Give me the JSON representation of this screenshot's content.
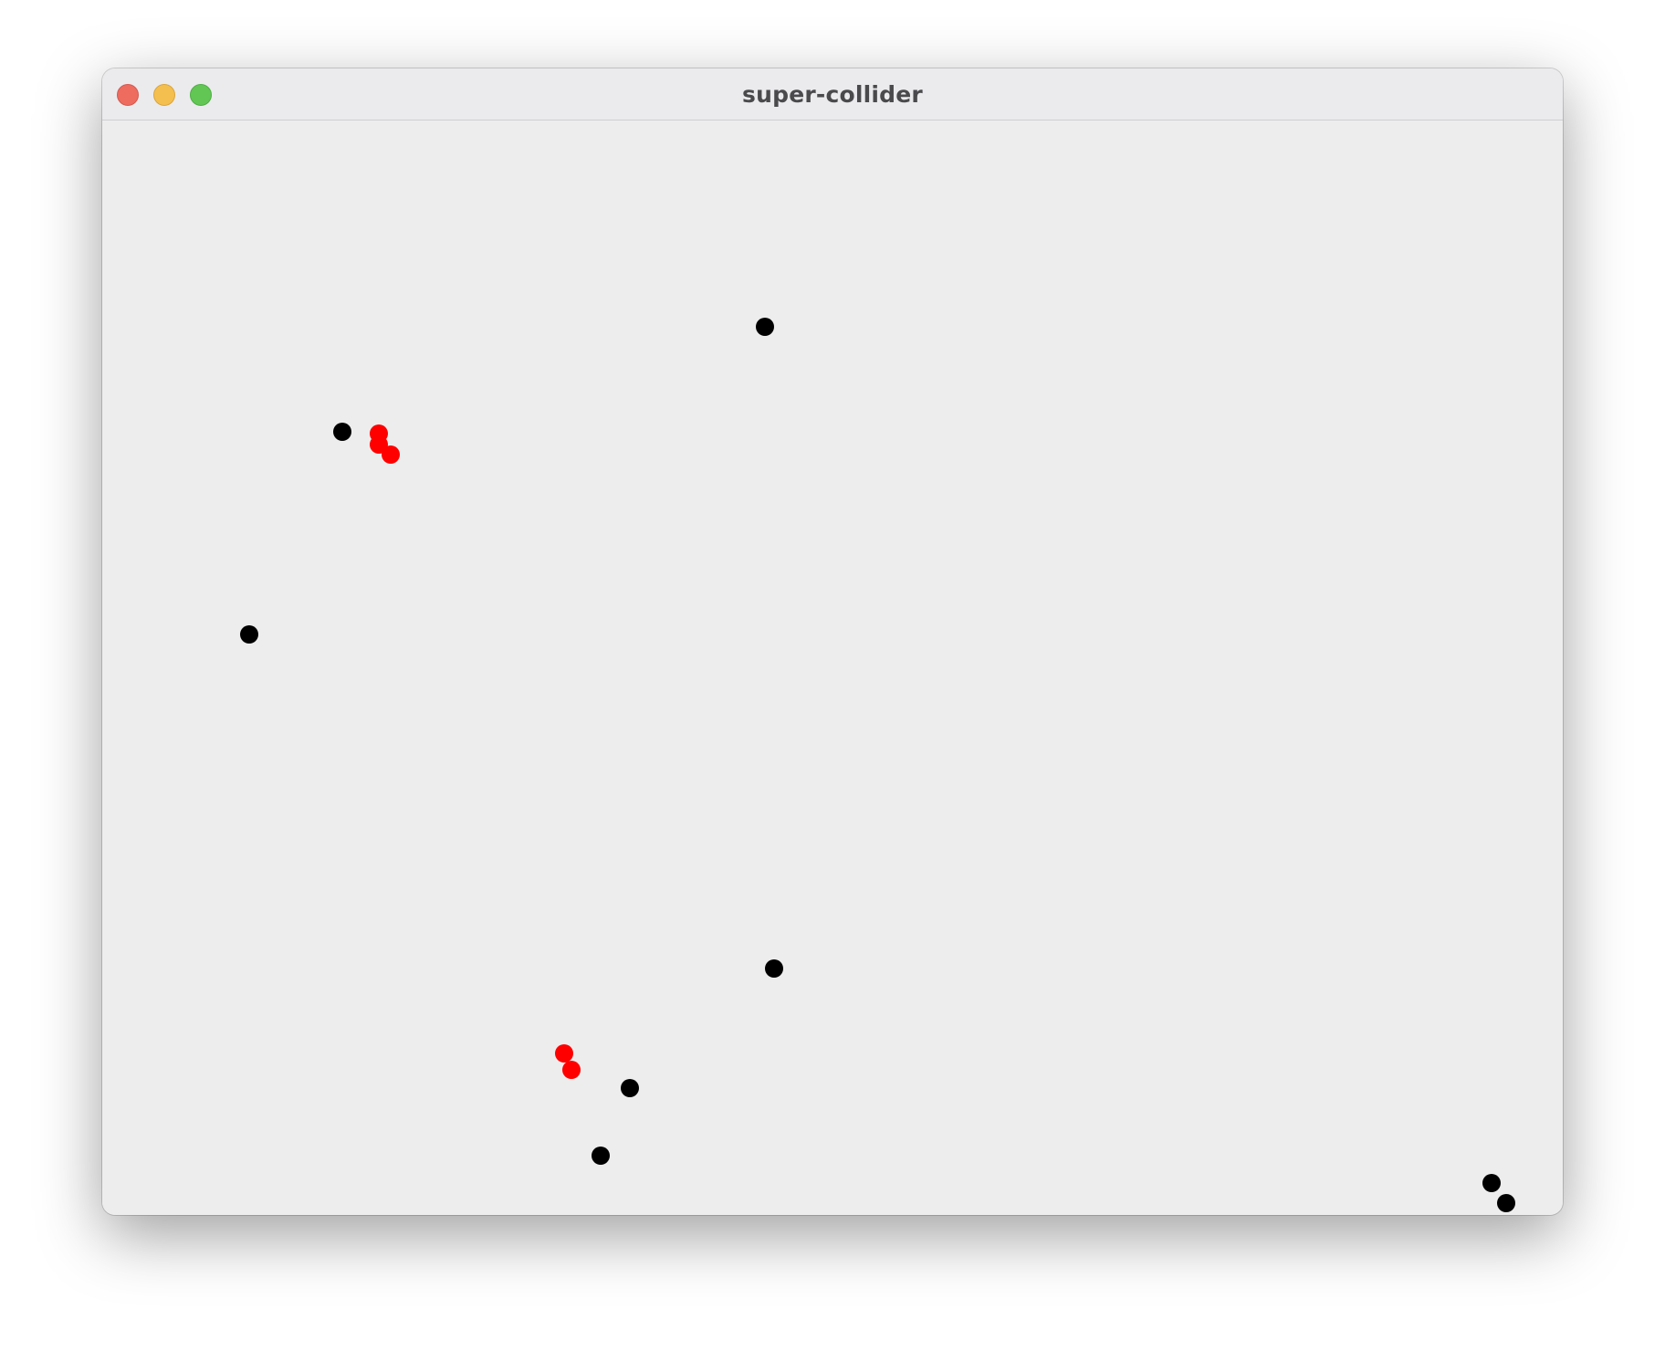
{
  "window": {
    "title": "super-collider"
  },
  "colors": {
    "particle_default": "#000000",
    "particle_colliding": "#ff0000",
    "canvas_background": "#ededed"
  },
  "particles": [
    {
      "state": "default"
    },
    {
      "state": "default"
    },
    {
      "state": "colliding"
    },
    {
      "state": "colliding"
    },
    {
      "state": "colliding"
    },
    {
      "state": "default"
    },
    {
      "state": "default"
    },
    {
      "state": "colliding"
    },
    {
      "state": "colliding"
    },
    {
      "state": "default"
    },
    {
      "state": "default"
    },
    {
      "state": "default"
    },
    {
      "state": "default"
    }
  ]
}
